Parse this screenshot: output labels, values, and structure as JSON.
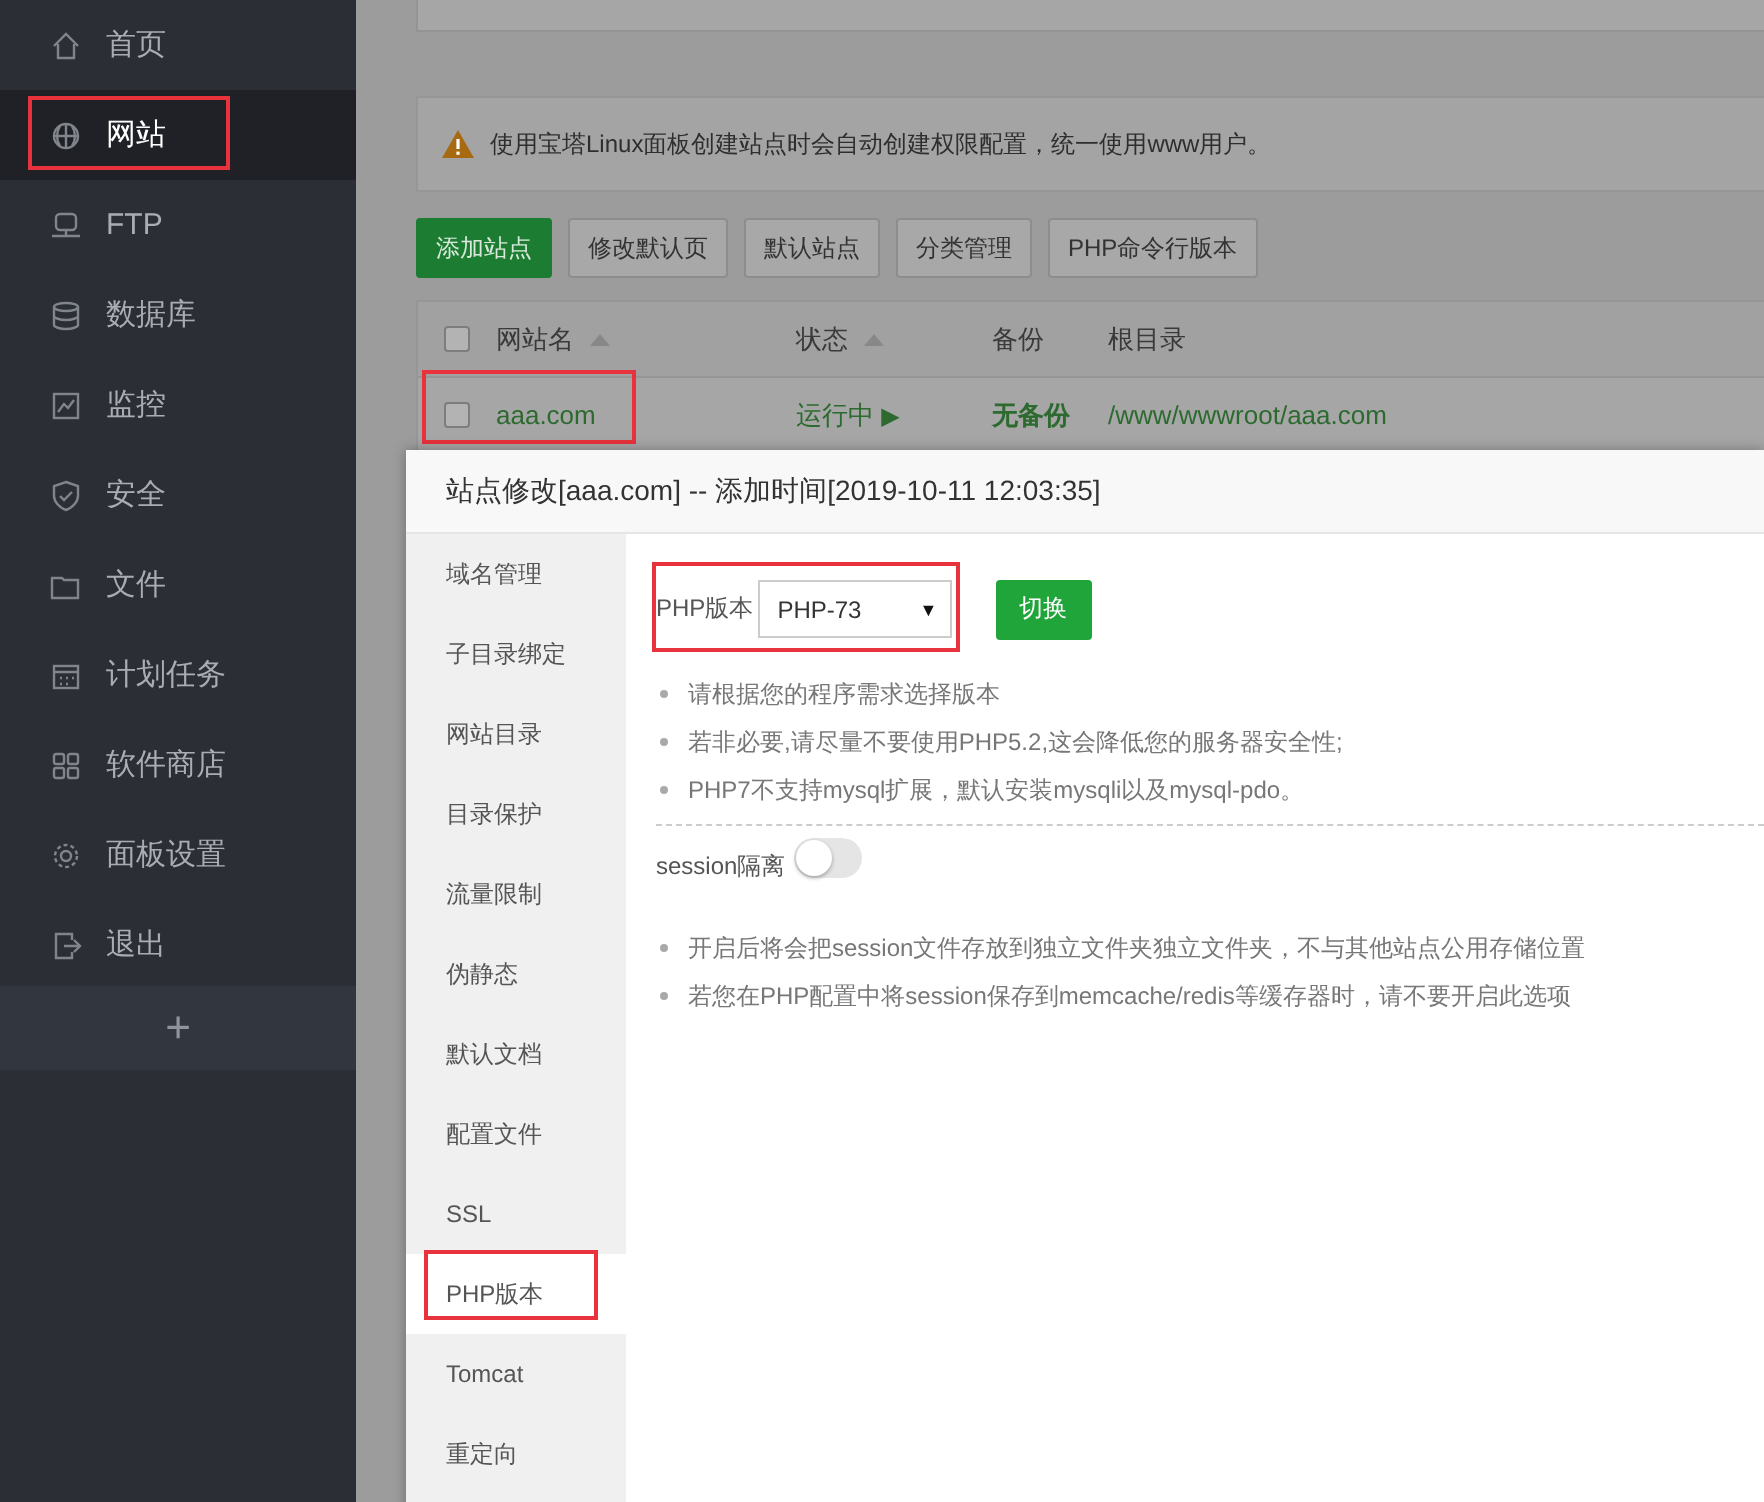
{
  "sidebar": {
    "items": [
      {
        "label": "首页",
        "selected": false,
        "highlighted": false
      },
      {
        "label": "网站",
        "selected": true,
        "highlighted": true
      },
      {
        "label": "FTP",
        "selected": false,
        "highlighted": false
      },
      {
        "label": "数据库",
        "selected": false,
        "highlighted": false
      },
      {
        "label": "监控",
        "selected": false,
        "highlighted": false
      },
      {
        "label": "安全",
        "selected": false,
        "highlighted": false
      },
      {
        "label": "文件",
        "selected": false,
        "highlighted": false
      },
      {
        "label": "计划任务",
        "selected": false,
        "highlighted": false
      },
      {
        "label": "软件商店",
        "selected": false,
        "highlighted": false
      },
      {
        "label": "面板设置",
        "selected": false,
        "highlighted": false
      },
      {
        "label": "退出",
        "selected": false,
        "highlighted": false
      }
    ],
    "add_label": "+"
  },
  "notice": {
    "text": "使用宝塔Linux面板创建站点时会自动创建权限配置，统一使用www用户。"
  },
  "toolbar": [
    {
      "label": "添加站点",
      "kind": "primary"
    },
    {
      "label": "修改默认页",
      "kind": "default"
    },
    {
      "label": "默认站点",
      "kind": "default"
    },
    {
      "label": "分类管理",
      "kind": "default"
    },
    {
      "label": "PHP命令行版本",
      "kind": "default"
    }
  ],
  "table": {
    "select_all_checked": false,
    "columns": [
      {
        "label": "网站名",
        "sortable": true
      },
      {
        "label": "状态",
        "sortable": true
      },
      {
        "label": "备份",
        "sortable": false
      },
      {
        "label": "根目录",
        "sortable": false
      }
    ],
    "rows": [
      {
        "checked": false,
        "highlighted": true,
        "name": "aaa.com",
        "status": "运行中",
        "status_icon": "▶",
        "backup": "无备份",
        "root": "/www/wwwroot/aaa.com"
      }
    ]
  },
  "dialog": {
    "title": "站点修改[aaa.com] -- 添加时间[2019-10-11 12:03:35]",
    "tabs": [
      {
        "label": "域名管理",
        "selected": false,
        "highlighted": false
      },
      {
        "label": "子目录绑定",
        "selected": false,
        "highlighted": false
      },
      {
        "label": "网站目录",
        "selected": false,
        "highlighted": false
      },
      {
        "label": "目录保护",
        "selected": false,
        "highlighted": false
      },
      {
        "label": "流量限制",
        "selected": false,
        "highlighted": false
      },
      {
        "label": "伪静态",
        "selected": false,
        "highlighted": false
      },
      {
        "label": "默认文档",
        "selected": false,
        "highlighted": false
      },
      {
        "label": "配置文件",
        "selected": false,
        "highlighted": false
      },
      {
        "label": "SSL",
        "selected": false,
        "highlighted": false
      },
      {
        "label": "PHP版本",
        "selected": true,
        "highlighted": true
      },
      {
        "label": "Tomcat",
        "selected": false,
        "highlighted": false
      },
      {
        "label": "重定向",
        "selected": false,
        "highlighted": false
      }
    ],
    "php": {
      "label": "PHP版本",
      "value": "PHP-73",
      "caret": "▼",
      "highlighted": true,
      "button": "切换"
    },
    "tips": [
      "请根据您的程序需求选择版本",
      "若非必要,请尽量不要使用PHP5.2,这会降低您的服务器安全性;",
      "PHP7不支持mysql扩展，默认安装mysqli以及mysql-pdo。"
    ],
    "session": {
      "label": "session隔离",
      "on": false
    },
    "session_tips": [
      "开启后将会把session文件存放到独立文件夹独立文件夹，不与其他站点公用存储位置",
      "若您在PHP配置中将session保存到memcache/redis等缓存器时，请不要开启此选项"
    ]
  }
}
